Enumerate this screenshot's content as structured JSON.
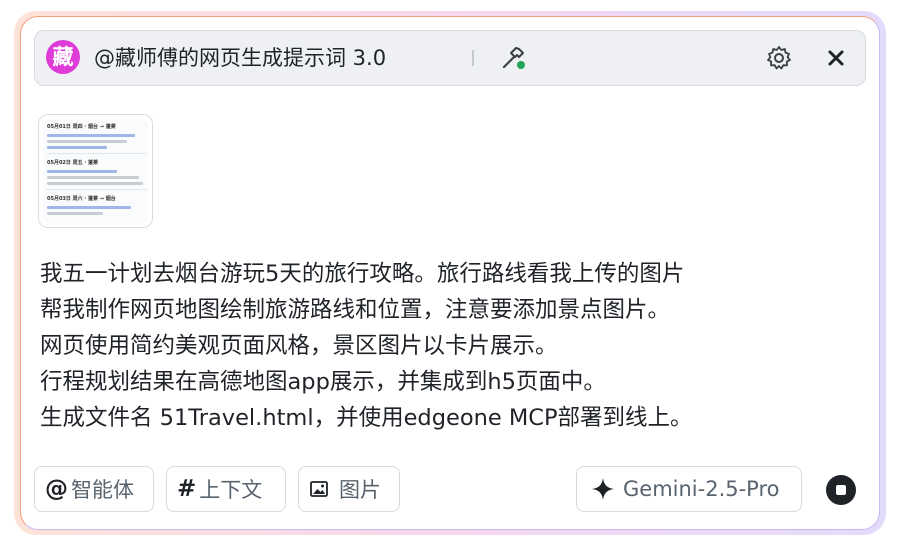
{
  "header": {
    "avatar_text": "藏",
    "title": "@藏师傅的网页生成提示词 3.0",
    "icons": [
      "hammer-icon",
      "gear-icon",
      "close-icon"
    ]
  },
  "attachment": {
    "sections": [
      {
        "heading": "05月01日 周四 · 烟台 → 蓬莱"
      },
      {
        "heading": "05月02日 周五 · 蓬莱"
      },
      {
        "heading": "05月03日 周六 · 蓬莱 → 烟台"
      }
    ]
  },
  "message": {
    "lines": [
      "我五一计划去烟台游玩5天的旅行攻略。旅行路线看我上传的图片",
      "帮我制作网页地图绘制旅游路线和位置，注意要添加景点图片。",
      "网页使用简约美观页面风格，景区图片以卡片展示。",
      "行程规划结果在高德地图app展示，并集成到h5页面中。",
      "生成文件名 51Travel.html，并使用edgeone MCP部署到线上。"
    ]
  },
  "toolbar": {
    "agent_symbol": "@",
    "agent_label": "智能体",
    "context_symbol": "#",
    "context_label": "上下文",
    "image_label": "图片",
    "model_label": "Gemini-2.5-Pro"
  },
  "colors": {
    "avatar": "#df3bd8",
    "status_dot": "#22a559",
    "text": "#1f2328",
    "muted": "#59636e"
  }
}
